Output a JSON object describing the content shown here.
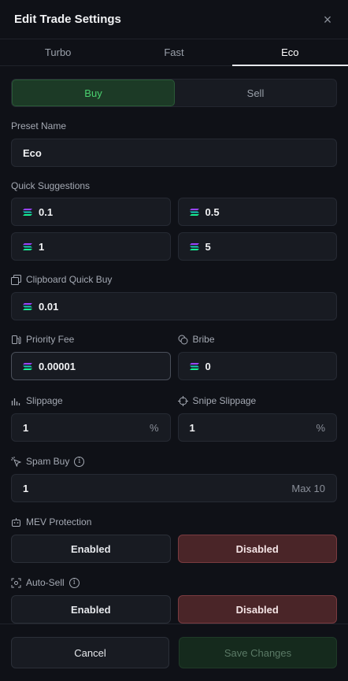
{
  "header": {
    "title": "Edit Trade Settings"
  },
  "tabs": [
    {
      "label": "Turbo"
    },
    {
      "label": "Fast"
    },
    {
      "label": "Eco"
    }
  ],
  "side": {
    "buy": "Buy",
    "sell": "Sell"
  },
  "preset": {
    "label": "Preset Name",
    "value": "Eco"
  },
  "quick": {
    "label": "Quick Suggestions",
    "values": [
      "0.1",
      "0.5",
      "1",
      "5"
    ]
  },
  "clipboard": {
    "label": "Clipboard Quick Buy",
    "value": "0.01"
  },
  "priority": {
    "label": "Priority Fee",
    "value": "0.00001"
  },
  "bribe": {
    "label": "Bribe",
    "value": "0"
  },
  "slippage": {
    "label": "Slippage",
    "value": "1",
    "suffix": "%"
  },
  "snipe": {
    "label": "Snipe Slippage",
    "value": "1",
    "suffix": "%"
  },
  "spam": {
    "label": "Spam Buy",
    "value": "1",
    "max": "Max 10"
  },
  "mev": {
    "label": "MEV Protection",
    "enabled": "Enabled",
    "disabled": "Disabled"
  },
  "autosell": {
    "label": "Auto-Sell",
    "enabled": "Enabled",
    "disabled": "Disabled"
  },
  "footer": {
    "cancel": "Cancel",
    "save": "Save Changes"
  },
  "colors": {
    "accent_green": "#4ad06f",
    "danger": "#4a2528",
    "bg": "#0f1117"
  }
}
